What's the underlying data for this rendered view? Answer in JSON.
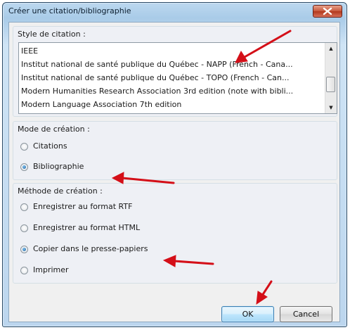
{
  "window": {
    "title": "Créer une citation/bibliographie"
  },
  "style_group": {
    "legend": "Style de citation :",
    "items": [
      "IEEE",
      "Institut national de santé publique du Québec - NAPP (French - Cana...",
      "Institut national de santé publique du Québec - TOPO (French - Can...",
      "Modern Humanities Research Association 3rd edition (note with bibli...",
      "Modern Language Association 7th edition"
    ],
    "scroll_up": "▲",
    "scroll_down": "▼"
  },
  "mode_group": {
    "legend": "Mode de création :",
    "options": [
      {
        "label": "Citations",
        "checked": false
      },
      {
        "label": "Bibliographie",
        "checked": true
      }
    ]
  },
  "method_group": {
    "legend": "Méthode de création :",
    "options": [
      {
        "label": "Enregistrer au format RTF",
        "checked": false
      },
      {
        "label": "Enregistrer au format HTML",
        "checked": false
      },
      {
        "label": "Copier dans le presse-papiers",
        "checked": true
      },
      {
        "label": "Imprimer",
        "checked": false
      }
    ]
  },
  "buttons": {
    "ok": "OK",
    "cancel": "Cancel"
  },
  "colors": {
    "annotation_arrow": "#d40f18",
    "close_button": "#c85a3f",
    "title_bar": "#a9cbe8"
  },
  "icons": {
    "close": "close-icon",
    "annotation": "red-arrow-icon"
  }
}
